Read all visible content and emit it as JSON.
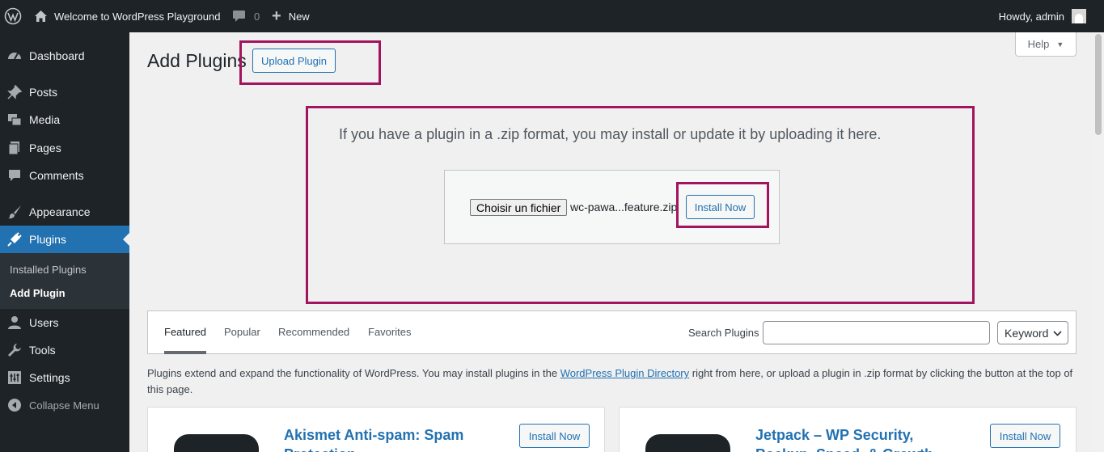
{
  "admin_bar": {
    "site_name": "Welcome to WordPress Playground",
    "comments_count": "0",
    "new_label": "New",
    "howdy": "Howdy, admin"
  },
  "sidebar": {
    "items": [
      {
        "label": "Dashboard",
        "icon": "dashboard-icon"
      },
      {
        "label": "Posts",
        "icon": "pin-icon"
      },
      {
        "label": "Media",
        "icon": "media-icon"
      },
      {
        "label": "Pages",
        "icon": "pages-icon"
      },
      {
        "label": "Comments",
        "icon": "comment-icon"
      },
      {
        "label": "Appearance",
        "icon": "brush-icon"
      },
      {
        "label": "Plugins",
        "icon": "plugin-icon"
      },
      {
        "label": "Users",
        "icon": "users-icon"
      },
      {
        "label": "Tools",
        "icon": "wrench-icon"
      },
      {
        "label": "Settings",
        "icon": "settings-icon"
      }
    ],
    "submenu": [
      {
        "label": "Installed Plugins"
      },
      {
        "label": "Add Plugin"
      }
    ],
    "collapse_label": "Collapse Menu"
  },
  "main": {
    "title": "Add Plugins",
    "upload_button": "Upload Plugin",
    "help_button": "Help",
    "upload_text": "If you have a plugin in a .zip format, you may install or update it by uploading it here.",
    "file_button": "Choisir un fichier",
    "file_name": "wc-pawa...feature.zip",
    "install_now": "Install Now"
  },
  "filter": {
    "tabs": [
      {
        "label": "Featured"
      },
      {
        "label": "Popular"
      },
      {
        "label": "Recommended"
      },
      {
        "label": "Favorites"
      }
    ],
    "search_label": "Search Plugins",
    "search_value": "",
    "search_type": "Keyword"
  },
  "intro": {
    "before": "Plugins extend and expand the functionality of WordPress. You may install plugins in the ",
    "link": "WordPress Plugin Directory",
    "after": " right from here, or upload a plugin in .zip format by clicking the button at the top of this page."
  },
  "cards": [
    {
      "name": "Akismet Anti-spam: Spam Protection",
      "install": "Install Now"
    },
    {
      "name": "Jetpack – WP Security, Backup, Speed, & Growth",
      "install": "Install Now"
    }
  ],
  "colors": {
    "admin_bg": "#1d2327",
    "accent": "#2271b1",
    "highlight": "#a3145f"
  }
}
